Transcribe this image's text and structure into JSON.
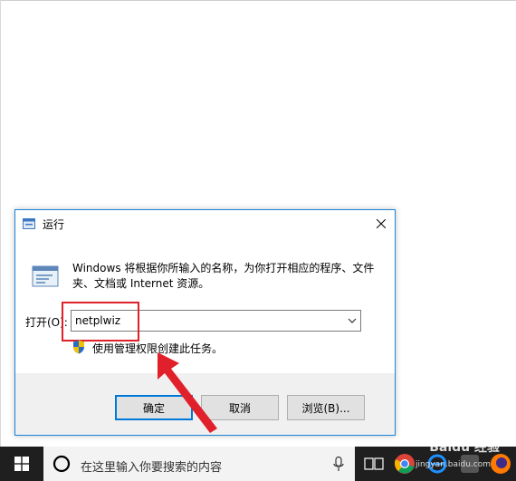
{
  "dialog": {
    "title": "运行",
    "description": "Windows 将根据你所输入的名称，为你打开相应的程序、文件夹、文档或 Internet 资源。",
    "open_label": "打开(O):",
    "open_value": "netplwiz",
    "admin_text": "使用管理权限创建此任务。",
    "ok_label": "确定",
    "cancel_label": "取消",
    "browse_label": "浏览(B)..."
  },
  "taskbar": {
    "search_placeholder": "在这里输入你要搜索的内容"
  },
  "watermark": {
    "text": "Baidu 经验",
    "sub": "jingyan.baidu.com"
  },
  "colors": {
    "accent": "#0078d7",
    "annotation_red": "#e0202a",
    "taskbar": "#1f1f1f"
  }
}
